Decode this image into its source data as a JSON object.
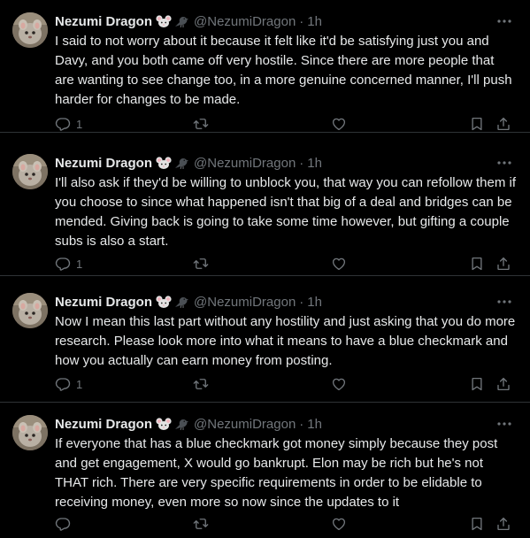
{
  "tweets": [
    {
      "name": "Nezumi Dragon",
      "handle": "@NezumiDragon",
      "separator": "·",
      "time": "1h",
      "text": "I said to not worry about it because it felt like it'd be satisfying just you and Davy, and you both came off very hostile. Since there are more people that are wanting to see change too, in a more genuine concerned manner, I'll push harder for changes to be made.",
      "reply_count": "1"
    },
    {
      "name": "Nezumi Dragon",
      "handle": "@NezumiDragon",
      "separator": "·",
      "time": "1h",
      "text": "I'll also ask if they'd be willing to unblock you, that way you can refollow them if you choose to since what happened isn't that big of a deal and bridges can be mended. Giving back is going to take some time however, but gifting a couple subs is also a start.",
      "reply_count": "1"
    },
    {
      "name": "Nezumi Dragon",
      "handle": "@NezumiDragon",
      "separator": "·",
      "time": "1h",
      "text": "Now I mean this last part without any hostility and just asking that you do more research. Please look more into what it means to have a blue checkmark and how you actually can earn money from posting.",
      "reply_count": "1"
    },
    {
      "name": "Nezumi Dragon",
      "handle": "@NezumiDragon",
      "separator": "·",
      "time": "1h",
      "text": "If everyone that has a blue checkmark got money simply because they post and get engagement, X would go bankrupt. Elon may be rich but he's not THAT rich. There are very specific requirements in order to be elidable to receiving money, even more so now since the updates to it",
      "reply_count": ""
    }
  ],
  "icons": {
    "name_emoji_1": "mouse-face-icon",
    "name_emoji_2": "black-bird-icon",
    "more": "more-icon",
    "reply": "reply-icon",
    "retweet": "retweet-icon",
    "like": "like-icon",
    "bookmark": "bookmark-icon",
    "share": "share-icon"
  },
  "colors": {
    "background": "#000000",
    "text": "#e7e9ea",
    "secondary": "#71767b",
    "divider": "#2f3336"
  }
}
